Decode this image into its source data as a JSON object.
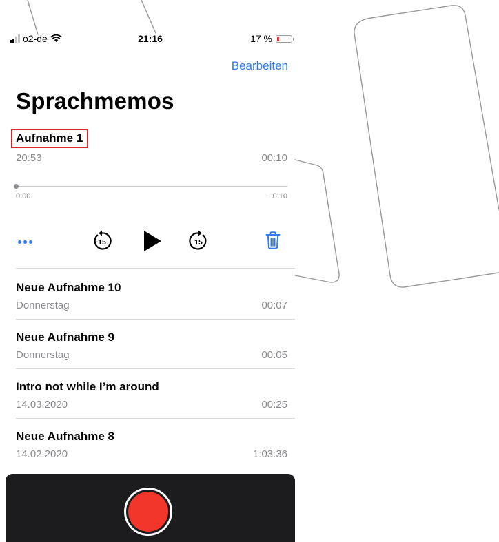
{
  "status_bar": {
    "carrier": "o2-de",
    "time": "21:16",
    "battery_percent": "17 %",
    "battery_level": 0.17
  },
  "nav": {
    "edit_label": "Bearbeiten"
  },
  "page_title": "Sprachmemos",
  "active_recording": {
    "title": "Aufnahme 1",
    "date": "20:53",
    "duration": "00:10",
    "elapsed": "0:00",
    "remaining": "−0:10",
    "progress": 0.0
  },
  "controls": {
    "skip_back_seconds": "15",
    "skip_forward_seconds": "15"
  },
  "recordings": [
    {
      "title": "Neue Aufnahme 10",
      "date": "Donnerstag",
      "duration": "00:07"
    },
    {
      "title": "Neue Aufnahme 9",
      "date": "Donnerstag",
      "duration": "00:05"
    },
    {
      "title": "Intro not while I’m around",
      "date": "14.03.2020",
      "duration": "00:25"
    },
    {
      "title": "Neue Aufnahme 8",
      "date": "14.02.2020",
      "duration": "1:03:36"
    }
  ],
  "colors": {
    "accent": "#2f7cf6",
    "record": "#f2362b",
    "highlight_box": "#d9262e",
    "bottom_bar": "#1c1c1e"
  }
}
